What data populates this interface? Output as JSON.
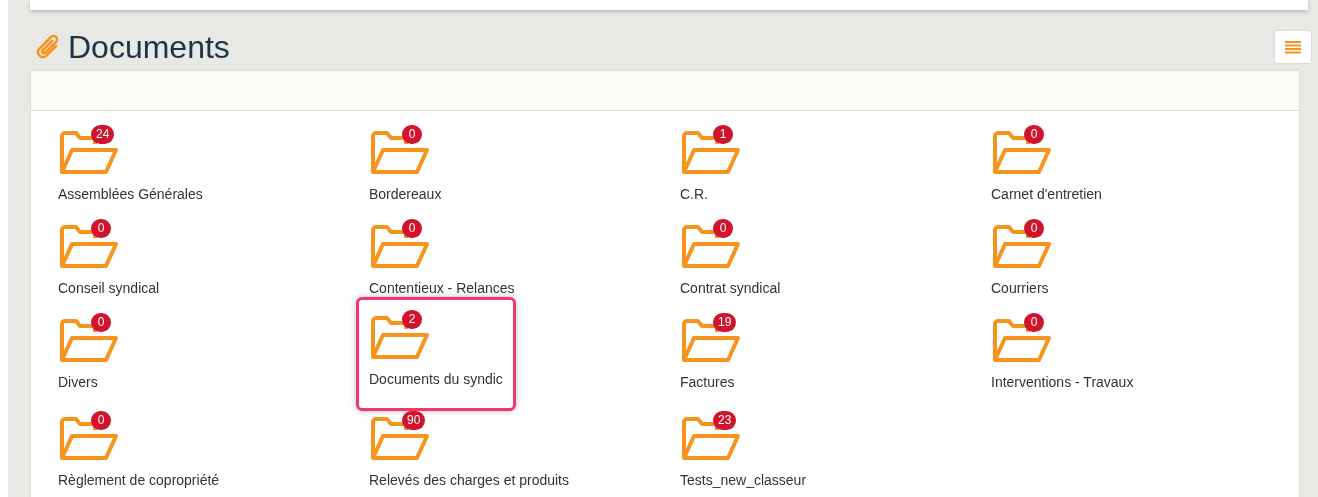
{
  "page": {
    "title": "Documents"
  },
  "folders": [
    {
      "label": "Assemblées Générales",
      "count": "24",
      "selected": false
    },
    {
      "label": "Bordereaux",
      "count": "0",
      "selected": false
    },
    {
      "label": "C.R.",
      "count": "1",
      "selected": false
    },
    {
      "label": "Carnet d'entretien",
      "count": "0",
      "selected": false
    },
    {
      "label": "Conseil syndical",
      "count": "0",
      "selected": false
    },
    {
      "label": "Contentieux - Relances",
      "count": "0",
      "selected": false
    },
    {
      "label": "Contrat syndical",
      "count": "0",
      "selected": false
    },
    {
      "label": "Courriers",
      "count": "0",
      "selected": false
    },
    {
      "label": "Divers",
      "count": "0",
      "selected": false
    },
    {
      "label": "Documents du syndic",
      "count": "2",
      "selected": true
    },
    {
      "label": "Factures",
      "count": "19",
      "selected": false
    },
    {
      "label": "Interventions - Travaux",
      "count": "0",
      "selected": false
    },
    {
      "label": "Règlement de copropriété",
      "count": "0",
      "selected": false
    },
    {
      "label": "Relevés des charges et produits",
      "count": "90",
      "selected": false
    },
    {
      "label": "Tests_new_classeur",
      "count": "23",
      "selected": false
    }
  ]
}
